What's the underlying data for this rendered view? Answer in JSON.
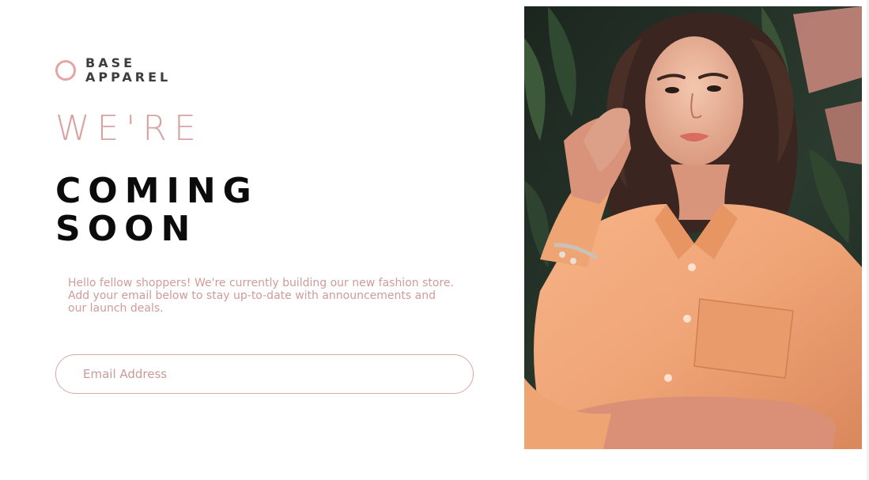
{
  "brand": {
    "line1": "BASE",
    "line2": "APPAREL",
    "accent_color": "#e8a4a4"
  },
  "headline": {
    "light": "WE'RE",
    "bold_line1": "COMING",
    "bold_line2": "SOON"
  },
  "description": {
    "line1": "Hello fellow shoppers! We're currently building our new fashion store.",
    "line2": "Add your email below to stay up-to-date with announcements and",
    "line3": "our launch deals."
  },
  "email_form": {
    "placeholder": "Email Address",
    "value": ""
  },
  "hero": {
    "icon": "hero-photo-woman-orange-shirt",
    "shirt_color": "#f0a577",
    "background_color": "#233026"
  }
}
